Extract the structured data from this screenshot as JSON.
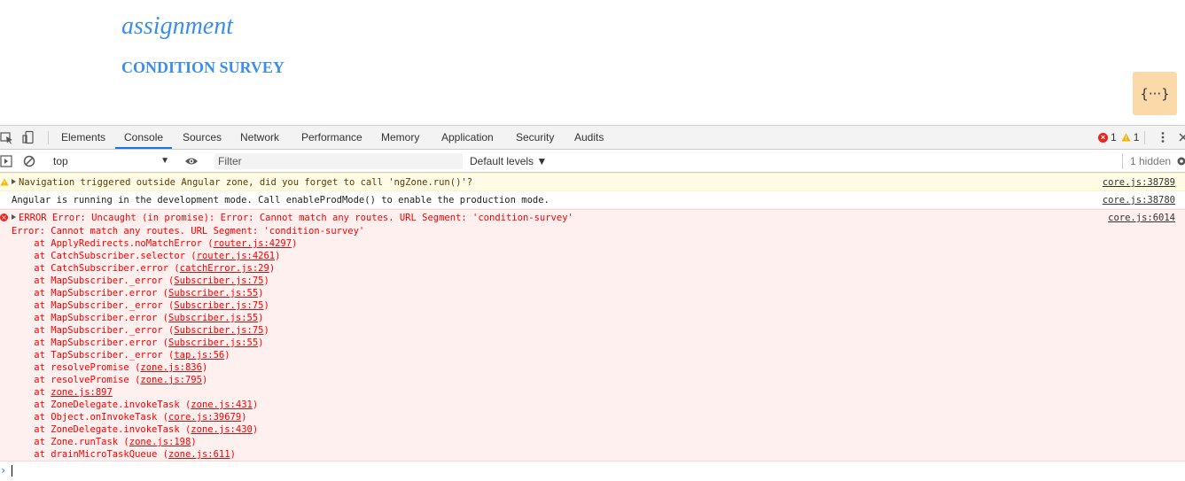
{
  "page": {
    "title": "assignment",
    "subtitle": "CONDITION SURVEY",
    "json_button_label": "{···}"
  },
  "devtools": {
    "tabs": [
      {
        "label": "Elements",
        "active": false
      },
      {
        "label": "Console",
        "active": true
      },
      {
        "label": "Sources",
        "active": false
      },
      {
        "label": "Network",
        "active": false
      },
      {
        "label": "Performance",
        "active": false
      },
      {
        "label": "Memory",
        "active": false
      },
      {
        "label": "Application",
        "active": false
      },
      {
        "label": "Security",
        "active": false
      },
      {
        "label": "Audits",
        "active": false
      }
    ],
    "error_count": "1",
    "warning_count": "1",
    "toolbar": {
      "context": "top",
      "filter_placeholder": "Filter",
      "levels": "Default levels ▼",
      "hidden": "1 hidden"
    },
    "messages": {
      "warning": {
        "text": "Navigation triggered outside Angular zone, did you forget to call 'ngZone.run()'?",
        "source": "core.js:38789"
      },
      "info": {
        "text": "Angular is running in the development mode. Call enableProdMode() to enable the production mode.",
        "source": "core.js:38780"
      },
      "error": {
        "header": "ERROR Error: Uncaught (in promise): Error: Cannot match any routes. URL Segment: 'condition-survey'",
        "source": "core.js:6014",
        "line2": "Error: Cannot match any routes. URL Segment: 'condition-survey'",
        "stack": [
          {
            "fn": "ApplyRedirects.noMatchError",
            "loc": "router.js:4297"
          },
          {
            "fn": "CatchSubscriber.selector",
            "loc": "router.js:4261"
          },
          {
            "fn": "CatchSubscriber.error",
            "loc": "catchError.js:29"
          },
          {
            "fn": "MapSubscriber._error",
            "loc": "Subscriber.js:75"
          },
          {
            "fn": "MapSubscriber.error",
            "loc": "Subscriber.js:55"
          },
          {
            "fn": "MapSubscriber._error",
            "loc": "Subscriber.js:75"
          },
          {
            "fn": "MapSubscriber.error",
            "loc": "Subscriber.js:55"
          },
          {
            "fn": "MapSubscriber._error",
            "loc": "Subscriber.js:75"
          },
          {
            "fn": "MapSubscriber.error",
            "loc": "Subscriber.js:55"
          },
          {
            "fn": "TapSubscriber._error",
            "loc": "tap.js:56"
          },
          {
            "fn": "resolvePromise",
            "loc": "zone.js:836"
          },
          {
            "fn": "resolvePromise",
            "loc": "zone.js:795"
          },
          {
            "fn": "",
            "loc": "zone.js:897"
          },
          {
            "fn": "ZoneDelegate.invokeTask",
            "loc": "zone.js:431"
          },
          {
            "fn": "Object.onInvokeTask",
            "loc": "core.js:39679"
          },
          {
            "fn": "ZoneDelegate.invokeTask",
            "loc": "zone.js:430"
          },
          {
            "fn": "Zone.runTask",
            "loc": "zone.js:198"
          },
          {
            "fn": "drainMicroTaskQueue",
            "loc": "zone.js:611"
          }
        ]
      }
    }
  },
  "colors": {
    "accent": "#3c8ee8",
    "error_bg": "#fff0f0",
    "warning_bg": "#fffbe5",
    "json_button_bg": "#fcd9a8"
  }
}
